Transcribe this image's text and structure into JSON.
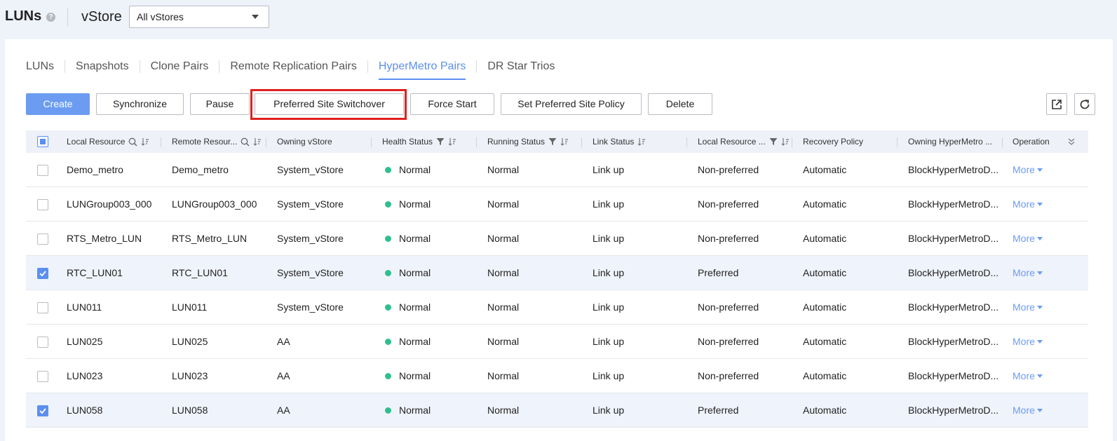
{
  "header": {
    "title": "LUNs",
    "help_icon": "?",
    "vstore_label": "vStore",
    "vstore_selected": "All vStores"
  },
  "tabs": [
    {
      "label": "LUNs",
      "active": false
    },
    {
      "label": "Snapshots",
      "active": false
    },
    {
      "label": "Clone Pairs",
      "active": false
    },
    {
      "label": "Remote Replication Pairs",
      "active": false
    },
    {
      "label": "HyperMetro Pairs",
      "active": true
    },
    {
      "label": "DR Star Trios",
      "active": false
    }
  ],
  "toolbar": {
    "create": "Create",
    "synchronize": "Synchronize",
    "pause": "Pause",
    "preferred_switchover": "Preferred Site Switchover",
    "force_start": "Force Start",
    "set_policy": "Set Preferred Site Policy",
    "delete": "Delete",
    "export_icon": "export-icon",
    "refresh_icon": "refresh-icon"
  },
  "table": {
    "columns": {
      "local_resource": "Local Resource",
      "remote_resource": "Remote Resour...",
      "owning_vstore": "Owning vStore",
      "health_status": "Health Status",
      "running_status": "Running Status",
      "link_status": "Link Status",
      "local_resource_role": "Local Resource ...",
      "recovery_policy": "Recovery Policy",
      "owning_hypermetro": "Owning HyperMetro ...",
      "operation": "Operation"
    },
    "rows": [
      {
        "checked": false,
        "local": "Demo_metro",
        "remote": "Demo_metro",
        "vstore": "System_vStore",
        "health": "Normal",
        "running": "Normal",
        "link": "Link up",
        "role": "Non-preferred",
        "recovery": "Automatic",
        "domain": "BlockHyperMetroD...",
        "op": "More"
      },
      {
        "checked": false,
        "local": "LUNGroup003_000",
        "remote": "LUNGroup003_000",
        "vstore": "System_vStore",
        "health": "Normal",
        "running": "Normal",
        "link": "Link up",
        "role": "Non-preferred",
        "recovery": "Automatic",
        "domain": "BlockHyperMetroD...",
        "op": "More"
      },
      {
        "checked": false,
        "local": "RTS_Metro_LUN",
        "remote": "RTS_Metro_LUN",
        "vstore": "System_vStore",
        "health": "Normal",
        "running": "Normal",
        "link": "Link up",
        "role": "Non-preferred",
        "recovery": "Automatic",
        "domain": "BlockHyperMetroD...",
        "op": "More"
      },
      {
        "checked": true,
        "local": "RTC_LUN01",
        "remote": "RTC_LUN01",
        "vstore": "System_vStore",
        "health": "Normal",
        "running": "Normal",
        "link": "Link up",
        "role": "Preferred",
        "recovery": "Automatic",
        "domain": "BlockHyperMetroD...",
        "op": "More"
      },
      {
        "checked": false,
        "local": "LUN011",
        "remote": "LUN011",
        "vstore": "System_vStore",
        "health": "Normal",
        "running": "Normal",
        "link": "Link up",
        "role": "Non-preferred",
        "recovery": "Automatic",
        "domain": "BlockHyperMetroD...",
        "op": "More"
      },
      {
        "checked": false,
        "local": "LUN025",
        "remote": "LUN025",
        "vstore": "AA",
        "health": "Normal",
        "running": "Normal",
        "link": "Link up",
        "role": "Non-preferred",
        "recovery": "Automatic",
        "domain": "BlockHyperMetroD...",
        "op": "More"
      },
      {
        "checked": false,
        "local": "LUN023",
        "remote": "LUN023",
        "vstore": "AA",
        "health": "Normal",
        "running": "Normal",
        "link": "Link up",
        "role": "Non-preferred",
        "recovery": "Automatic",
        "domain": "BlockHyperMetroD...",
        "op": "More"
      },
      {
        "checked": true,
        "local": "LUN058",
        "remote": "LUN058",
        "vstore": "AA",
        "health": "Normal",
        "running": "Normal",
        "link": "Link up",
        "role": "Preferred",
        "recovery": "Automatic",
        "domain": "BlockHyperMetroD...",
        "op": "More"
      }
    ]
  },
  "colors": {
    "accent": "#5b8ff0",
    "primary_button": "#6b9cf2",
    "status_normal": "#2fbf8f",
    "highlight": "#e02020"
  }
}
